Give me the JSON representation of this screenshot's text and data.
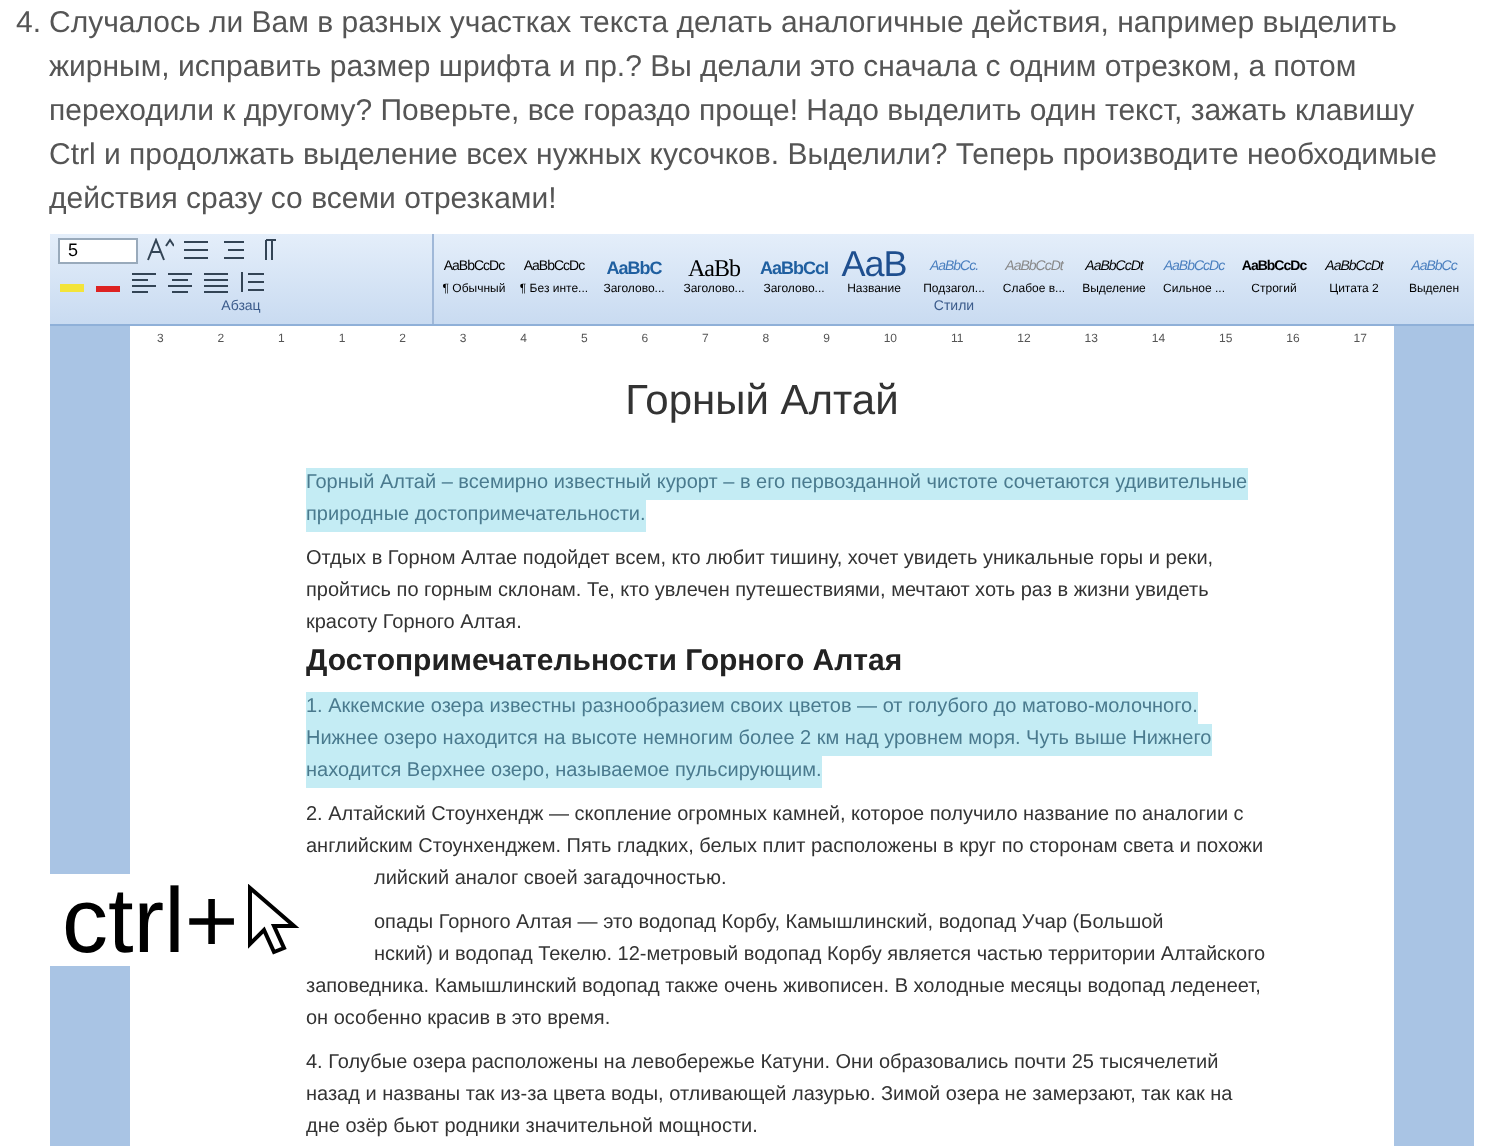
{
  "article": {
    "marker": "4.",
    "text": "Случалось ли Вам в разных участках текста делать аналогичные действия, например выделить жирным, исправить размер шрифта и пр.? Вы делали это сначала с одним отрезком, а потом переходили к другому? Поверьте, все гораздо проще! Надо выделить один текст, зажать клавишу Ctrl и продолжать выделение всех нужных кусочков. Выделили? Теперь производите необходимые действия сразу со всеми отрезками!"
  },
  "ribbon": {
    "font_size": "5",
    "groups": [
      "Абзац",
      "Стили"
    ],
    "styles": [
      {
        "preview": "AaBbCcDc",
        "label": "¶ Обычный",
        "kind": "normal"
      },
      {
        "preview": "AaBbCcDc",
        "label": "¶ Без инте...",
        "kind": "normal"
      },
      {
        "preview": "AaBbC",
        "label": "Заголово...",
        "kind": "heading"
      },
      {
        "preview": "AaBb",
        "label": "Заголово...",
        "kind": "big"
      },
      {
        "preview": "AaBbCcI",
        "label": "Заголово...",
        "kind": "heading"
      },
      {
        "preview": "AaB",
        "label": "Название",
        "kind": "title"
      },
      {
        "preview": "AaBbCc.",
        "label": "Подзагол...",
        "kind": "italic"
      },
      {
        "preview": "AaBbCcDt",
        "label": "Слабое в...",
        "kind": "faint"
      },
      {
        "preview": "AaBbCcDt",
        "label": "Выделение",
        "kind": "emphasis"
      },
      {
        "preview": "AaBbCcDc",
        "label": "Сильное ...",
        "kind": "italic"
      },
      {
        "preview": "AaBbCcDc",
        "label": "Строгий",
        "kind": "strong"
      },
      {
        "preview": "AaBbCcDt",
        "label": "Цитата 2",
        "kind": "emphasis"
      },
      {
        "preview": "AaBbCc",
        "label": "Выделен",
        "kind": "italic"
      }
    ]
  },
  "ruler": [
    "3",
    "2",
    "1",
    "1",
    "2",
    "3",
    "4",
    "5",
    "6",
    "7",
    "8",
    "9",
    "10",
    "11",
    "12",
    "13",
    "14",
    "15",
    "16",
    "17"
  ],
  "document": {
    "title": "Горный Алтай",
    "blocks": [
      {
        "kind": "para",
        "selected": true,
        "lines": [
          {
            "text": "Горный Алтай  – всемирно известный курорт  – в его первозданной чистоте сочетаются удивительные",
            "hidden_start": false
          },
          {
            "text": "природные достопримечательности.",
            "hidden_start": false
          }
        ]
      },
      {
        "kind": "para",
        "selected": false,
        "lines": [
          {
            "text": "Отдых в Горном Алтае подойдет всем, кто любит тишину, хочет увидеть уникальные горы и реки,",
            "hidden_start": false
          },
          {
            "text": "пройтись по горным склонам. Те, кто увлечен путешествиями, мечтают хоть раз в жизни  увидеть",
            "hidden_start": false
          },
          {
            "text": "красоту Горного Алтая.",
            "hidden_start": false
          }
        ]
      },
      {
        "kind": "heading",
        "selected": false,
        "lines": [
          {
            "text": "Достопримечательности  Горного Алтая",
            "hidden_start": false
          }
        ]
      },
      {
        "kind": "para",
        "selected": true,
        "lines": [
          {
            "text": "1. Аккемские озера известны разнообразием своих цветов — от голубого до матово-молочного.",
            "hidden_start": false
          },
          {
            "text": "Нижнее озеро находится на высоте немногим более 2 км над уровнем моря. Чуть выше Нижнего",
            "hidden_start": false
          },
          {
            "text": "находится Верхнее озеро, называемое пульсирующим.",
            "hidden_start": false
          }
        ]
      },
      {
        "kind": "para",
        "selected": false,
        "lines": [
          {
            "text": "2. Алтайский Стоунхендж — скопление огромных камней, которое получило название по аналогии с",
            "hidden_start": false
          },
          {
            "text": "английским Стоунхенджем. Пять гладких, белых плит расположены в круг по сторонам света и похожи",
            "hidden_start": false
          },
          {
            "text": "лийский аналог своей загадочностью.",
            "hidden_start": true
          }
        ]
      },
      {
        "kind": "para",
        "selected": false,
        "lines": [
          {
            "text": "опады Горного Алтая — это водопад Корбу, Камышлинский, водопад Учар (Большой",
            "hidden_start": true
          },
          {
            "text": "нский) и водопад Текелю. 12-метровый водопад Корбу является частью территории Алтайского",
            "hidden_start": true
          },
          {
            "text": "заповедника. Камышлинский водопад также очень живописен. В холодные месяцы водопад леденеет,",
            "hidden_start": false
          },
          {
            "text": "он особенно красив в это время.",
            "hidden_start": false
          }
        ]
      },
      {
        "kind": "para",
        "selected": false,
        "lines": [
          {
            "text": "4. Голубые озера расположены на левобережье Катуни. Они образовались почти 25 тысячелетий",
            "hidden_start": false
          },
          {
            "text": "назад и названы так из-за цвета воды, отливающей лазурью. Зимой озера не замерзают, так как на",
            "hidden_start": false
          },
          {
            "text": "дне озёр бьют родники значительной мощности.",
            "hidden_start": false
          }
        ]
      }
    ]
  },
  "overlay": {
    "text": "ctrl+"
  }
}
